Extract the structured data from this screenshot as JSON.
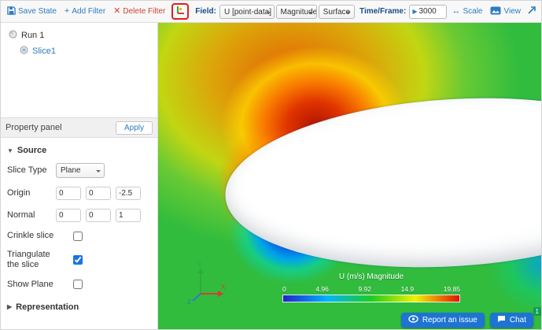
{
  "toolbar": {
    "save_state_label": "Save State",
    "add_filter_label": "Add Filter",
    "delete_filter_label": "Delete Filter",
    "field_label": "Field:",
    "field_value": "U [point-data]",
    "component_value": "Magnitude",
    "surface_value": "Surface",
    "time_label": "Time/Frame:",
    "time_value": "3000",
    "scale_label": "Scale",
    "view_label": "View"
  },
  "pipeline": [
    {
      "label": "Run 1"
    },
    {
      "label": "Slice1"
    }
  ],
  "properties": {
    "panel_title": "Property panel",
    "apply_label": "Apply",
    "source_section": "Source",
    "slice_type_label": "Slice Type",
    "slice_type_value": "Plane",
    "origin_label": "Origin",
    "origin": [
      "0",
      "0",
      "-2.5"
    ],
    "normal_label": "Normal",
    "normal": [
      "0",
      "0",
      "1"
    ],
    "crinkle_label": "Crinkle slice",
    "triangulate_label": "Triangulate the slice",
    "show_plane_label": "Show Plane",
    "representation_section": "Representation"
  },
  "viewport": {
    "legend_title": "U (m/s) Magnitude",
    "legend_ticks": [
      "0",
      "4.96",
      "9.92",
      "14.9",
      "19.85"
    ],
    "axis_x": "X",
    "axis_y": "Y",
    "axis_z": "Z"
  },
  "footer": {
    "report_label": "Report an issue",
    "chat_label": "Chat",
    "badge": "1"
  },
  "colors": {
    "accent": "#2d7bc1",
    "danger": "#d23f31",
    "legend_min": "#2222cc",
    "legend_max": "#e31400",
    "field_green": "#31bc3e"
  }
}
